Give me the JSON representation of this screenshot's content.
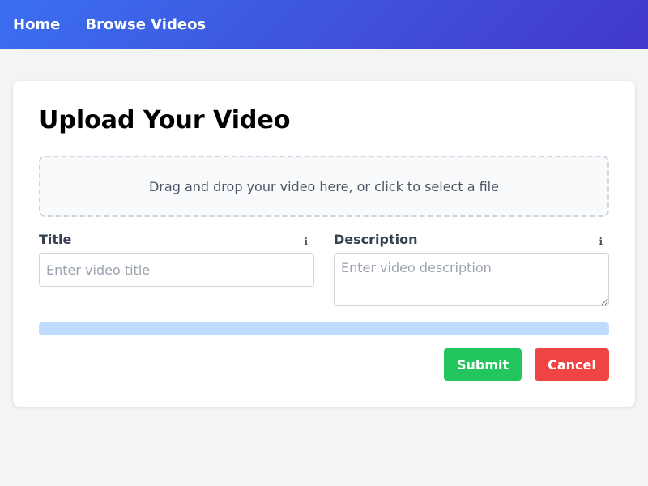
{
  "nav": {
    "items": [
      {
        "label": "Home"
      },
      {
        "label": "Browse Videos"
      }
    ]
  },
  "upload": {
    "title": "Upload Your Video",
    "dropzone_text": "Drag and drop your video here, or click to select a file",
    "title_field": {
      "label": "Title",
      "placeholder": "Enter video title",
      "value": "",
      "info_icon": "ℹ"
    },
    "description_field": {
      "label": "Description",
      "placeholder": "Enter video description",
      "value": "",
      "info_icon": "ℹ"
    },
    "progress": {
      "percent": 0
    },
    "submit_label": "Submit",
    "cancel_label": "Cancel"
  },
  "colors": {
    "nav_gradient_start": "#3b6ff0",
    "nav_gradient_end": "#4338ca",
    "submit": "#22c55e",
    "cancel": "#ef4444",
    "progress_track": "#bfdbfe"
  }
}
